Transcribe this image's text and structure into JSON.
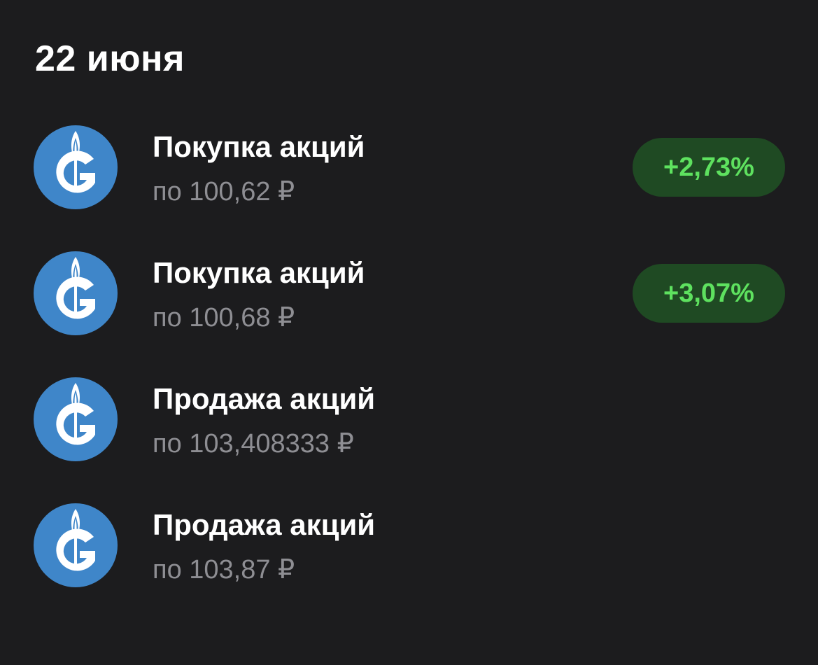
{
  "header": {
    "date": "22 июня"
  },
  "operations": [
    {
      "icon": "gazprom-logo-icon",
      "title": "Покупка акций",
      "price": "по 100,62 ₽",
      "change": "+2,73%"
    },
    {
      "icon": "gazprom-logo-icon",
      "title": "Покупка акций",
      "price": "по 100,68 ₽",
      "change": "+3,07%"
    },
    {
      "icon": "gazprom-logo-icon",
      "title": "Продажа акций",
      "price": "по 103,408333 ₽"
    },
    {
      "icon": "gazprom-logo-icon",
      "title": "Продажа акций",
      "price": "по 103,87 ₽"
    }
  ],
  "colors": {
    "background": "#1c1c1e",
    "logo": "#3f86c9",
    "positive_text": "#5ee15f",
    "positive_badge": "#1f4a23",
    "secondary_text": "#8e8e93"
  }
}
